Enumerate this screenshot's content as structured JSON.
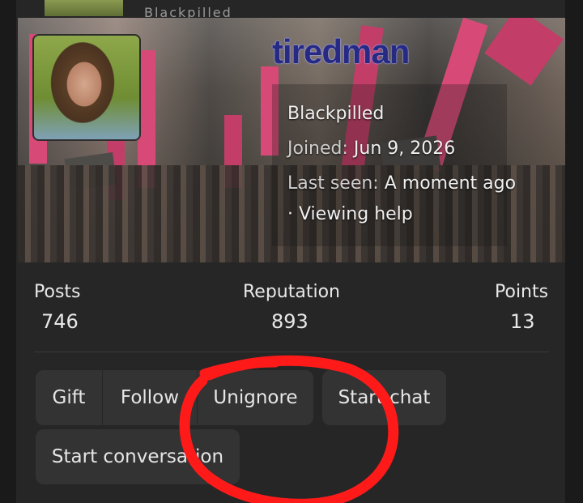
{
  "profile": {
    "username": "tiredman",
    "title": "Blackpilled",
    "joined_label": "Joined:",
    "joined_date": "Jun 9, 2026",
    "last_seen_label": "Last seen:",
    "last_seen_value": "A moment ago",
    "activity": "· Viewing help",
    "top_peek_text": "Blackpilled"
  },
  "stats": {
    "posts_label": "Posts",
    "posts_value": "746",
    "reputation_label": "Reputation",
    "reputation_value": "893",
    "points_label": "Points",
    "points_value": "13"
  },
  "actions": {
    "gift": "Gift",
    "follow": "Follow",
    "unignore": "Unignore",
    "start_chat": "Start chat",
    "start_conversation": "Start conversation"
  },
  "colors": {
    "username": "#262a85",
    "annotation_circle": "#ff1a1a",
    "button_bg": "#333333",
    "card_bg": "#262626"
  },
  "icons": {
    "annotation": "red-hand-drawn-circle"
  }
}
